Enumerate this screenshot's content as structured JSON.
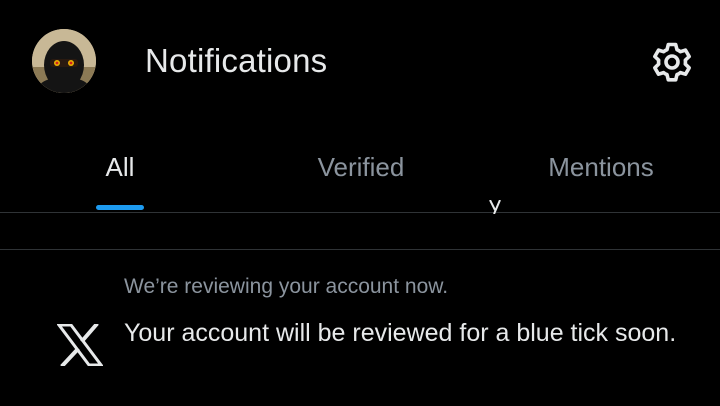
{
  "header": {
    "title": "Notifications",
    "avatar_icon": "profile-avatar",
    "settings_icon": "gear-icon"
  },
  "tabs": [
    {
      "label": "All",
      "active": true
    },
    {
      "label": "Verified",
      "active": false
    },
    {
      "label": "Mentions",
      "active": false
    }
  ],
  "colors": {
    "background": "#000000",
    "text_primary": "#e7e9ea",
    "text_secondary": "#8b949e",
    "accent": "#1d9bf0",
    "divider": "#2f3336"
  },
  "notification": {
    "icon": "x-logo-icon",
    "subtitle": "We’re reviewing your account now.",
    "message": "Your account will be reviewed for a blue tick soon."
  }
}
